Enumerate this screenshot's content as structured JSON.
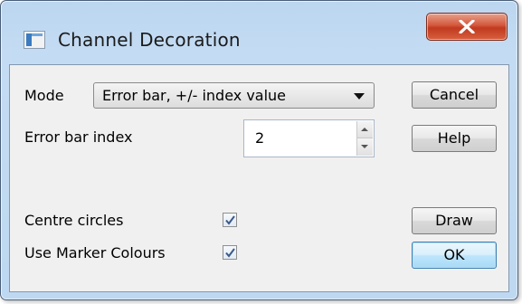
{
  "window": {
    "title": "Channel Decoration",
    "close_label": "X"
  },
  "mode": {
    "label": "Mode",
    "value": "Error bar, +/- index value"
  },
  "error_bar_index": {
    "label": "Error bar index",
    "value": "2"
  },
  "centre_circles": {
    "label": "Centre circles",
    "checked": true
  },
  "use_marker_colours": {
    "label": "Use Marker Colours",
    "checked": true
  },
  "buttons": {
    "cancel": "Cancel",
    "help": "Help",
    "draw": "Draw",
    "ok": "OK"
  },
  "icons": [
    "app-icon",
    "close-icon",
    "chevron-down-icon",
    "spin-up-icon",
    "spin-down-icon",
    "check-icon"
  ]
}
